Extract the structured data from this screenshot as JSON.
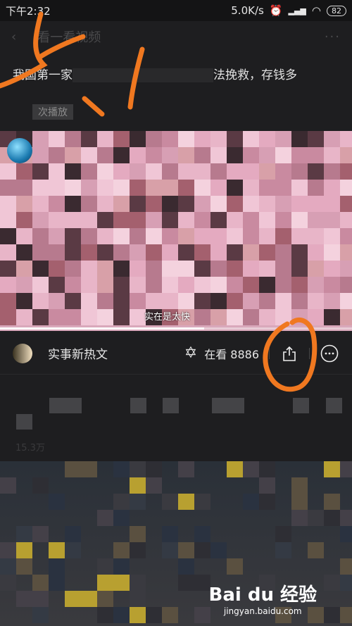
{
  "status_bar": {
    "time": "下午2:32",
    "network_speed": "5.0K/s",
    "battery": "82"
  },
  "navbar": {
    "title": "看一看视频",
    "back_icon": "chevron-left-icon",
    "more_icon": "more-dots-icon"
  },
  "article": {
    "headline_start": "我国第一家",
    "headline_end": "法挽救，存钱多",
    "tag": "次播放"
  },
  "video": {
    "subtitle": "实在是太快",
    "progress": 0.58
  },
  "info_bar": {
    "author": "实事新热文",
    "watching_label": "在看 8886"
  },
  "below": {
    "meta": "15.3万"
  },
  "watermark": {
    "logo": "Bai du 经验",
    "url": "jingyan.baidu.com"
  },
  "colors": {
    "annotation": "#f07820",
    "background": "#1e1e20"
  }
}
